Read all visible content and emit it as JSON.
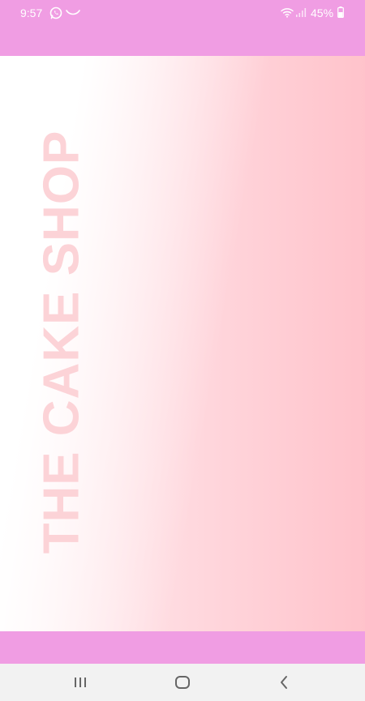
{
  "status_bar": {
    "time": "9:57",
    "battery_percent": "45%",
    "icons": [
      "whatsapp-icon",
      "call-icon",
      "wifi-icon",
      "signal-icon",
      "battery-icon"
    ]
  },
  "hero": {
    "title": "THE CAKE SHOP"
  },
  "navigation": {
    "buttons": [
      "recents-icon",
      "home-icon",
      "back-icon"
    ]
  },
  "colors": {
    "app_bar": "#f09de3",
    "title_text": "#fcd3d7",
    "gradient_light": "#ffffff",
    "gradient_pink": "#ffc3cb",
    "nav_bar": "#f2f2f2",
    "nav_icon": "#666666"
  }
}
